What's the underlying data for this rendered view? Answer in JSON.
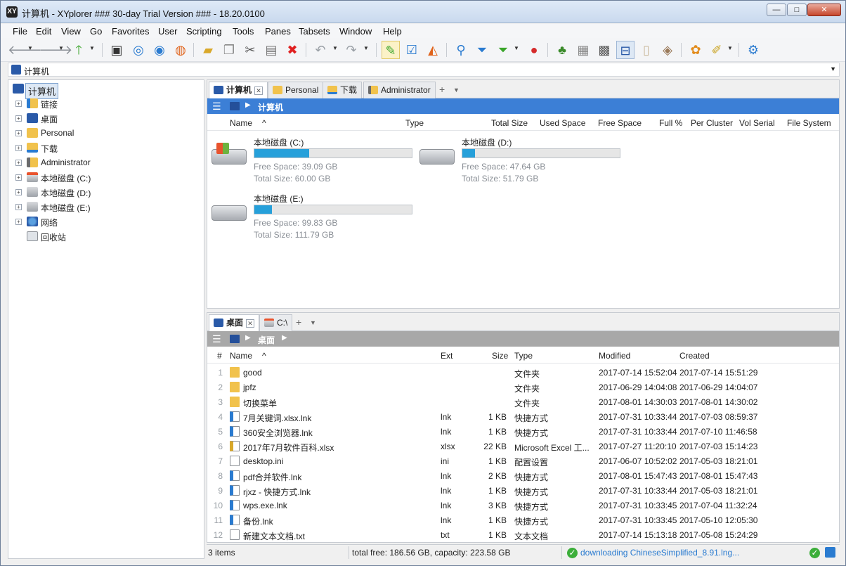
{
  "window": {
    "title": "计算机 - XYplorer ### 30-day Trial Version ### - 18.20.0100",
    "app_icon": "XY"
  },
  "menu": [
    "File",
    "Edit",
    "View",
    "Go",
    "Favorites",
    "User",
    "Scripting",
    "Tools",
    "Panes",
    "Tabsets",
    "Window",
    "Help"
  ],
  "address": {
    "value": "计算机"
  },
  "tree": {
    "root": "计算机",
    "items": [
      "链接",
      "桌面",
      "Personal",
      "下载",
      "Administrator",
      "本地磁盘 (C:)",
      "本地磁盘 (D:)",
      "本地磁盘 (E:)",
      "网络",
      "回收站"
    ]
  },
  "top_pane": {
    "tabs": [
      "计算机",
      "Personal",
      "下载",
      "Administrator"
    ],
    "breadcrumb": "计算机",
    "columns": [
      "Name",
      "Type",
      "Total Size",
      "Used Space",
      "Free Space",
      "Full %",
      "Per Cluster",
      "Vol Serial",
      "File System"
    ],
    "drives": [
      {
        "name": "本地磁盘 (C:)",
        "free": "Free Space: 39.09 GB",
        "total": "Total Size: 60.00 GB",
        "used_pct": 35
      },
      {
        "name": "本地磁盘 (D:)",
        "free": "Free Space: 47.64 GB",
        "total": "Total Size: 51.79 GB",
        "used_pct": 8
      },
      {
        "name": "本地磁盘 (E:)",
        "free": "Free Space: 99.83 GB",
        "total": "Total Size: 111.79 GB",
        "used_pct": 11
      }
    ]
  },
  "bottom_pane": {
    "tabs": [
      "桌面",
      "C:\\"
    ],
    "breadcrumb": "桌面",
    "columns": [
      "#",
      "Name",
      "Ext",
      "Size",
      "Type",
      "Modified",
      "Created"
    ],
    "files": [
      {
        "n": "1",
        "name": "good",
        "ext": "",
        "size": "",
        "type": "文件夹",
        "modified": "2017-07-14 15:52:04",
        "created": "2017-07-14 15:51:29",
        "icon": "folder"
      },
      {
        "n": "2",
        "name": "jpfz",
        "ext": "",
        "size": "",
        "type": "文件夹",
        "modified": "2017-06-29 14:04:08",
        "created": "2017-06-29 14:04:07",
        "icon": "folder"
      },
      {
        "n": "3",
        "name": "切换菜单",
        "ext": "",
        "size": "",
        "type": "文件夹",
        "modified": "2017-08-01 14:30:03",
        "created": "2017-08-01 14:30:02",
        "icon": "folder"
      },
      {
        "n": "4",
        "name": "7月关键词.xlsx.lnk",
        "ext": "lnk",
        "size": "1 KB",
        "type": "快捷方式",
        "modified": "2017-07-31 10:33:44",
        "created": "2017-07-03 08:59:37",
        "icon": "lnk"
      },
      {
        "n": "5",
        "name": "360安全浏览器.lnk",
        "ext": "lnk",
        "size": "1 KB",
        "type": "快捷方式",
        "modified": "2017-07-31 10:33:44",
        "created": "2017-07-10 11:46:58",
        "icon": "lnk"
      },
      {
        "n": "6",
        "name": "2017年7月软件百科.xlsx",
        "ext": "xlsx",
        "size": "22 KB",
        "type": "Microsoft Excel 工...",
        "modified": "2017-07-27 11:20:10",
        "created": "2017-07-03 15:14:23",
        "icon": "xlsx"
      },
      {
        "n": "7",
        "name": "desktop.ini",
        "ext": "ini",
        "size": "1 KB",
        "type": "配置设置",
        "modified": "2017-06-07 10:52:02",
        "created": "2017-05-03 18:21:01",
        "icon": "ini"
      },
      {
        "n": "8",
        "name": "pdf合并软件.lnk",
        "ext": "lnk",
        "size": "2 KB",
        "type": "快捷方式",
        "modified": "2017-08-01 15:47:43",
        "created": "2017-08-01 15:47:43",
        "icon": "lnk"
      },
      {
        "n": "9",
        "name": "rjxz - 快捷方式.lnk",
        "ext": "lnk",
        "size": "1 KB",
        "type": "快捷方式",
        "modified": "2017-07-31 10:33:44",
        "created": "2017-05-03 18:21:01",
        "icon": "lnk"
      },
      {
        "n": "10",
        "name": "wps.exe.lnk",
        "ext": "lnk",
        "size": "3 KB",
        "type": "快捷方式",
        "modified": "2017-07-31 10:33:45",
        "created": "2017-07-04 11:32:24",
        "icon": "lnk"
      },
      {
        "n": "11",
        "name": "备份.lnk",
        "ext": "lnk",
        "size": "1 KB",
        "type": "快捷方式",
        "modified": "2017-07-31 10:33:45",
        "created": "2017-05-10 12:05:30",
        "icon": "lnk"
      },
      {
        "n": "12",
        "name": "新建文本文档.txt",
        "ext": "txt",
        "size": "1 KB",
        "type": "文本文档",
        "modified": "2017-07-14 15:13:18",
        "created": "2017-05-08 15:24:29",
        "icon": "txt"
      }
    ]
  },
  "status": {
    "items": "3 items",
    "space": "total free: 186.56 GB, capacity: 223.58 GB",
    "download": "downloading ChineseSimplified_8.91.lng..."
  },
  "colors": {
    "accent": "#3c7fd6",
    "progress": "#26a0da",
    "folder": "#f1c24c"
  }
}
